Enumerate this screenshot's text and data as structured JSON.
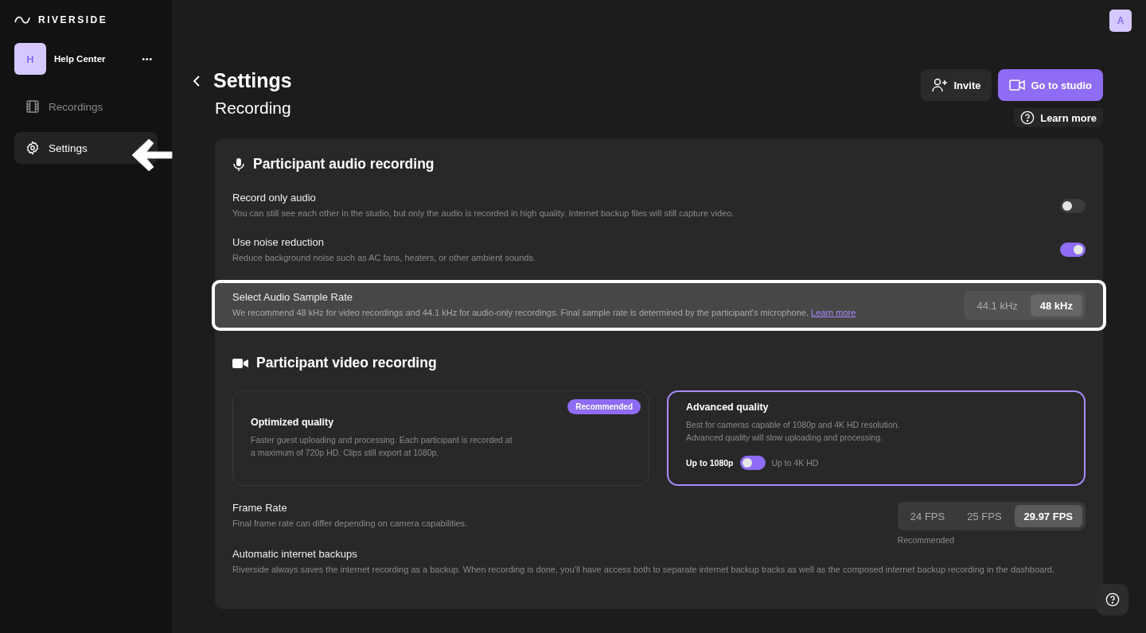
{
  "sidebar": {
    "logo": "RIVERSIDE",
    "workspace": {
      "avatar": "H",
      "name": "Help Center",
      "menu": "•••"
    },
    "items": [
      {
        "label": "Recordings",
        "kind": "film",
        "selected": false
      },
      {
        "label": "Settings",
        "kind": "gear",
        "selected": true
      }
    ]
  },
  "header": {
    "avatar": "A",
    "title": "Settings",
    "subtitle": "Recording",
    "invite": "Invite",
    "studio": "Go to studio",
    "learn_more": "Learn more"
  },
  "audio": {
    "title": "Participant audio recording",
    "rows": [
      {
        "kind": "toggle",
        "title": "Record only audio",
        "description": "You can still see each other in the studio, but only the audio is recorded in high quality. Internet backup files will still capture video.",
        "on": false,
        "highlighted": false
      },
      {
        "kind": "toggle",
        "title": "Use noise reduction",
        "description": "Reduce background noise such as AC fans, heaters, or other ambient sounds.",
        "on": true,
        "highlighted": false
      },
      {
        "kind": "segmented",
        "title": "Select Audio Sample Rate",
        "description": "We recommend 48 kHz for video recordings and 44.1 kHz for audio-only recordings. Final sample rate is determined by the participant's microphone.",
        "link": "Learn more",
        "highlighted": true,
        "options": [
          {
            "label": "44.1 kHz",
            "selected": false
          },
          {
            "label": "48 kHz",
            "selected": true
          }
        ]
      }
    ]
  },
  "video": {
    "title": "Participant video recording",
    "qualities": [
      {
        "title": "Optimized quality",
        "badge": "Recommended",
        "description": "Faster guest uploading and processing. Each participant is recorded at a maximum of 720p HD. Clips still export at 1080p.",
        "selected": false
      },
      {
        "title": "Advanced quality",
        "description": "Best for cameras capable of 1080p and 4K HD resolution.\nAdvanced quality will slow uploading and processing.",
        "selected": true,
        "resolution": {
          "left": "Up to 1080p",
          "right": "Up to 4K HD",
          "on": false
        }
      }
    ],
    "frame_rate": {
      "title": "Frame Rate",
      "description": "Final frame rate can differ depending on camera capabilities.",
      "options": [
        {
          "label": "24 FPS",
          "selected": false
        },
        {
          "label": "25 FPS",
          "selected": false
        },
        {
          "label": "29.97 FPS",
          "selected": true
        }
      ],
      "note": "Recommended"
    },
    "backups": {
      "title": "Automatic internet backups",
      "description": "Riverside always saves the internet recording as a backup. When recording is done, you'll have access both to separate internet backup tracks as well as the composed internet backup recording in the dashboard."
    }
  }
}
